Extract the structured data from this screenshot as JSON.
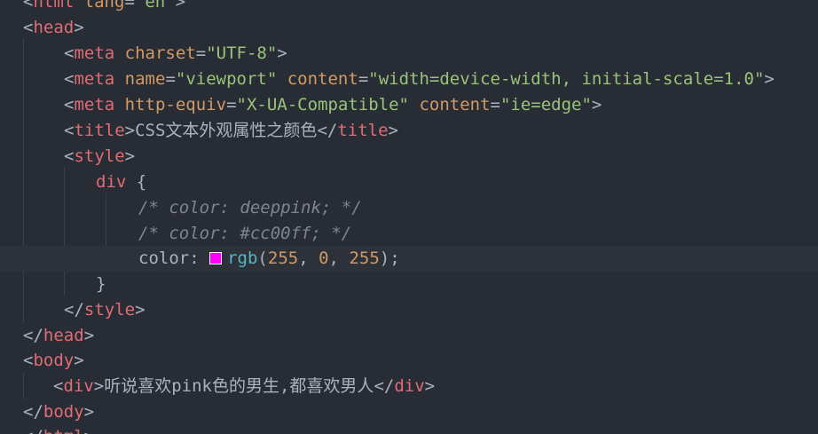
{
  "editor": {
    "accent_swatch": "#ff00ff",
    "lines": {
      "l0": {
        "lt": "<",
        "tag": "html",
        "a1": "lang",
        "eq": "=",
        "v1": "\"en\"",
        "gt": ">"
      },
      "l1": {
        "open": "<",
        "tag": "head",
        "close": ">"
      },
      "l2": {
        "lt": "<",
        "tag": "meta",
        "a1": "charset",
        "eq": "=",
        "v1": "\"UTF-8\"",
        "gt": ">"
      },
      "l3": {
        "lt": "<",
        "tag": "meta",
        "a1": "name",
        "eq1": "=",
        "v1": "\"viewport\"",
        "a2": "content",
        "eq2": "=",
        "v2": "\"width=device-width, initial-scale=1.0\"",
        "gt": ">"
      },
      "l4": {
        "lt": "<",
        "tag": "meta",
        "a1": "http-equiv",
        "eq1": "=",
        "v1": "\"X-UA-Compatible\"",
        "a2": "content",
        "eq2": "=",
        "v2": "\"ie=edge\"",
        "gt": ">"
      },
      "l5": {
        "lt": "<",
        "tag": "title",
        "gt": ">",
        "text": "CSS文本外观属性之颜色",
        "lt2": "</",
        "tag2": "title",
        "gt2": ">"
      },
      "l6": {
        "lt": "<",
        "tag": "style",
        "gt": ">"
      },
      "l7": {
        "selector": "div",
        "brace": " {"
      },
      "l8": {
        "comment": "/* color: deeppink; */"
      },
      "l9": {
        "comment": "/* color: #cc00ff; */"
      },
      "l10": {
        "prop": "color",
        "colon": ": ",
        "fn": "rgb",
        "open": "(",
        "n1": "255",
        "c1": ", ",
        "n2": "0",
        "c2": ", ",
        "n3": "255",
        "close": ");"
      },
      "l11": {
        "brace": "}"
      },
      "l12": {
        "lt": "</",
        "tag": "style",
        "gt": ">"
      },
      "l13": {
        "lt": "</",
        "tag": "head",
        "gt": ">"
      },
      "l14": {
        "lt": "<",
        "tag": "body",
        "gt": ">"
      },
      "l15": {
        "lt": "<",
        "tag": "div",
        "gt": ">",
        "text": "听说喜欢pink色的男生,都喜欢男人",
        "lt2": "</",
        "tag2": "div",
        "gt2": ">"
      },
      "l16": {
        "lt": "</",
        "tag": "body",
        "gt": ">"
      },
      "l17": {
        "lt": "</",
        "tag": "html",
        "gt": ">"
      }
    }
  }
}
